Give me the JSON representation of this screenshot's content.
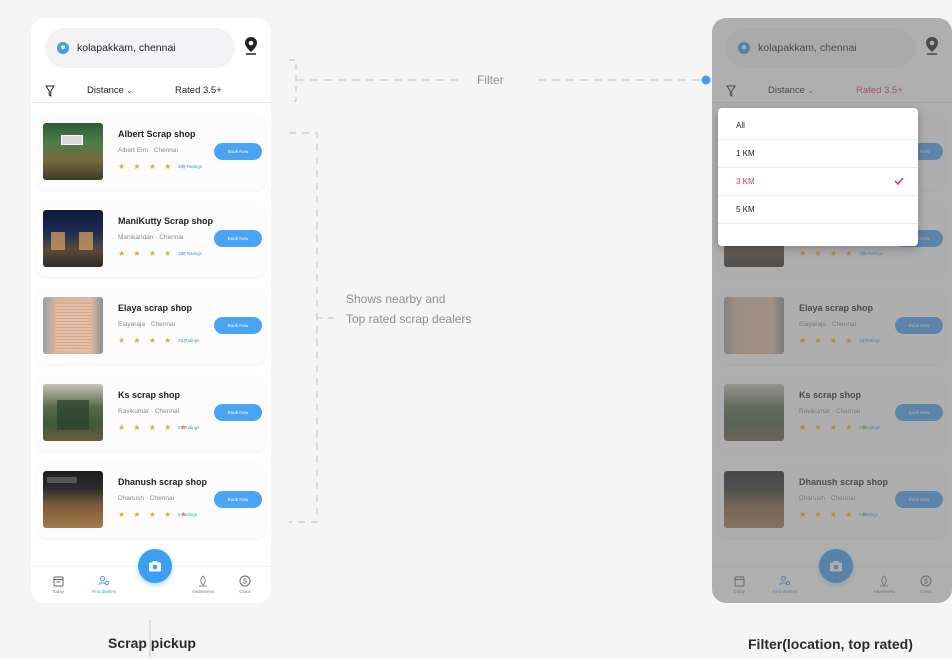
{
  "annotations": {
    "filter_label": "Filter",
    "list_label_line1": "Shows nearby and",
    "list_label_line2": "Top rated scrap dealers",
    "left_caption": "Scrap pickup",
    "right_caption": "Filter(location, top rated)"
  },
  "app": {
    "location": "kolapakkam, chennai",
    "filter": {
      "distance_label": "Distance",
      "rated_label": "Rated 3.5+"
    },
    "book_label": "Book Now",
    "shops": [
      {
        "name": "Albert Scrap shop",
        "owner": "Albert Eim · Chennai",
        "stars": "★ ★ ★ ★ ☆",
        "rating_value": 4,
        "ratings": "345 Ratings"
      },
      {
        "name": "ManiKutty Scrap shop",
        "owner": "Manikandan · Chennai",
        "stars": "★ ★ ★ ★ ☆",
        "rating_value": 4,
        "ratings": "100 Ratings"
      },
      {
        "name": "Elaya scrap shop",
        "owner": "Elayaraja · Chennai",
        "stars": "★ ★ ★ ★ ☆",
        "rating_value": 4,
        "ratings": "34 Ratings"
      },
      {
        "name": "Ks scrap shop",
        "owner": "Ravikumar · Chennai",
        "stars": "★ ★ ★ ★ ★",
        "rating_value": 5,
        "ratings": "27 Ratings"
      },
      {
        "name": "Dhanush scrap shop",
        "owner": "Dhanush · Chennai",
        "stars": "★ ★ ★ ★ ★",
        "rating_value": 5,
        "ratings": "5 Ratings"
      }
    ],
    "nav": {
      "today": "Today",
      "find_dealers": "Find dealers",
      "awareness": "Awareness",
      "coins": "Coins",
      "active": "find_dealers"
    },
    "distance_options": [
      "All",
      "1 KM",
      "3 KM",
      "5 KM"
    ],
    "selected_option": "3 KM"
  },
  "colors": {
    "accent": "#3d9ef3",
    "selected": "#d6336c",
    "star": "#f5a623"
  },
  "icons": [
    "location-pin-icon",
    "map-pin-icon",
    "funnel-icon",
    "chevron-down-icon",
    "star-icon",
    "camera-icon",
    "calendar-icon",
    "dealers-icon",
    "awareness-icon",
    "coins-icon",
    "checkmark-icon"
  ]
}
